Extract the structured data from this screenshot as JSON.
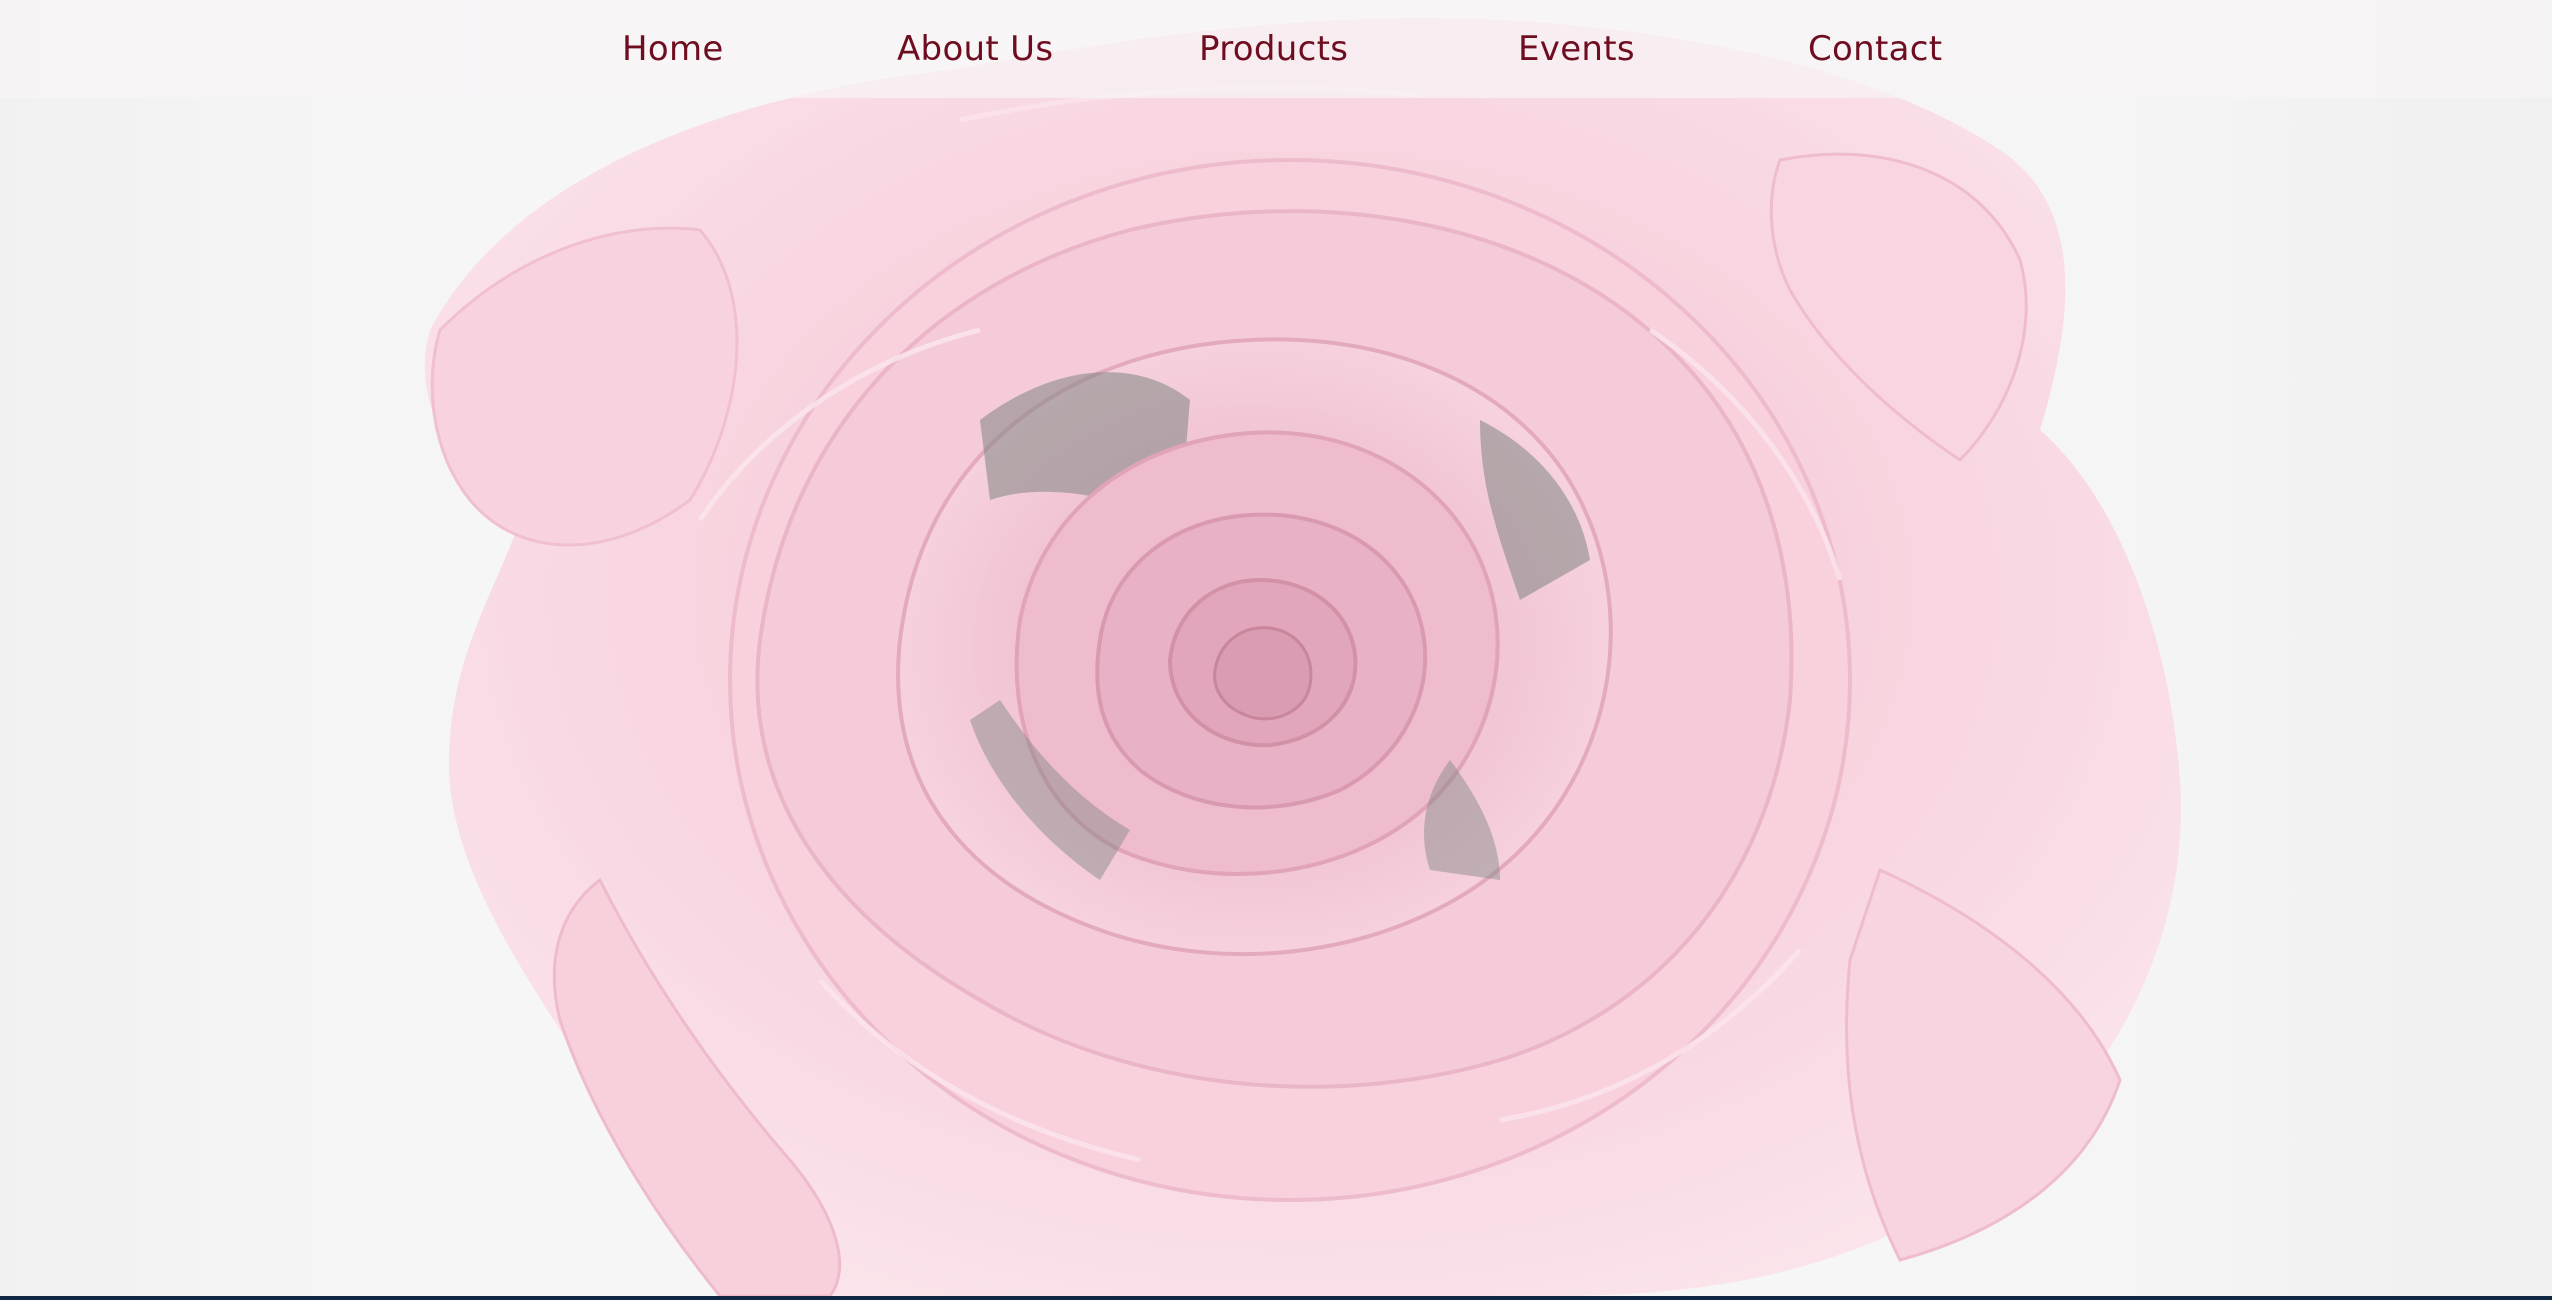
{
  "nav": {
    "items": [
      {
        "label": "Home"
      },
      {
        "label": "About Us"
      },
      {
        "label": "Products"
      },
      {
        "label": "Events"
      },
      {
        "label": "Contact"
      }
    ]
  },
  "hero": {
    "image": "pink-rose-photo"
  },
  "colors": {
    "nav_text": "#6e0d20",
    "bottom_line": "#0f2742"
  }
}
